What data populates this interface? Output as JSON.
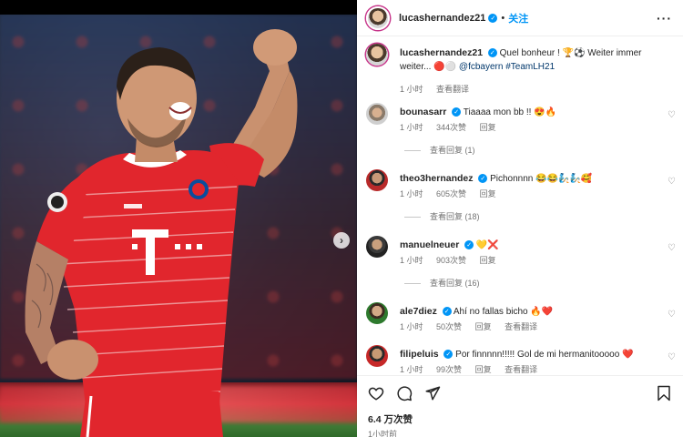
{
  "post": {
    "author": "lucashernandez21",
    "follow_label": "关注",
    "separator": "•",
    "caption_text": "Quel bonheur ! 🏆⚽ Weiter immer weiter... 🔴⚪",
    "caption_tags": "@fcbayern #TeamLH21",
    "caption_time": "1 小时",
    "translate_label": "查看翻译",
    "likes": "6.4 万次赞",
    "posted_time": "1小时前"
  },
  "comments": [
    {
      "user": "bounasarr",
      "text": "Tiaaaa mon bb !!",
      "emoji": "😍🔥",
      "time": "1 小时",
      "likes": "344次赞",
      "reply_label": "回复",
      "view_replies": "查看回复 (1)"
    },
    {
      "user": "theo3hernandez",
      "text": "Pichonnnn",
      "emoji": "😂😂🧞🧞🥰",
      "time": "1 小时",
      "likes": "605次赞",
      "reply_label": "回复",
      "view_replies": "查看回复 (18)"
    },
    {
      "user": "manuelneuer",
      "text": "",
      "emoji": "💛❌",
      "time": "1 小时",
      "likes": "903次赞",
      "reply_label": "回复",
      "view_replies": "查看回复 (16)"
    },
    {
      "user": "ale7diez",
      "text": "Ahí no fallas bicho",
      "emoji": "🔥❤️",
      "time": "1 小时",
      "likes": "50次赞",
      "reply_label": "回复",
      "translate_label": "查看翻译"
    },
    {
      "user": "filipeluis",
      "text": "Por finnnnn!!!!! Gol de mi hermanitooooo",
      "emoji": "❤️",
      "time": "1 小时",
      "likes": "99次赞",
      "reply_label": "回复",
      "translate_label": "查看翻译"
    }
  ],
  "icons": {
    "more": "more-options-icon",
    "verified": "verified-badge-icon",
    "heart": "heart-icon",
    "comment": "comment-icon",
    "share": "share-icon",
    "bookmark": "bookmark-icon",
    "next": "chevron-right-icon"
  },
  "colors": {
    "accent": "#0095f6",
    "jersey": "#e1262d",
    "text": "#262626",
    "muted": "#737373"
  }
}
